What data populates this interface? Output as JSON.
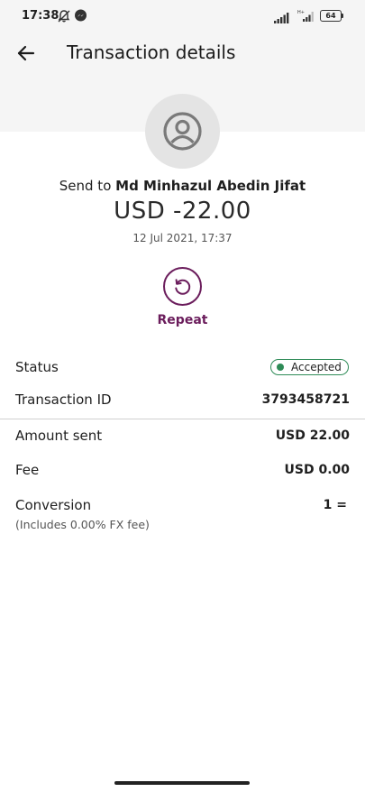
{
  "status_bar": {
    "time": "17:38",
    "battery": "64",
    "icons": [
      "alarm-off-icon",
      "messenger-icon",
      "signal-icon",
      "signal-icon",
      "battery-icon"
    ]
  },
  "header": {
    "title": "Transaction details",
    "back_icon": "arrow-left-icon"
  },
  "recipient": {
    "prefix": "Send to",
    "name": "Md Minhazul Abedin Jifat",
    "avatar_icon": "user-circle-icon"
  },
  "amount": "USD -22.00",
  "datetime": "12 Jul 2021, 17:37",
  "repeat": {
    "label": "Repeat",
    "icon": "repeat-icon"
  },
  "details": {
    "status_label": "Status",
    "status_value": "Accepted",
    "transaction_id_label": "Transaction ID",
    "transaction_id_value": "3793458721",
    "amount_sent_label": "Amount sent",
    "amount_sent_value": "USD 22.00",
    "fee_label": "Fee",
    "fee_value": "USD 0.00",
    "conversion_label": "Conversion",
    "conversion_value": "1 =",
    "fx_note": "(Includes 0.00% FX fee)"
  },
  "colors": {
    "accent": "#6b1d5c",
    "status_green": "#2e8b57",
    "header_bg": "#f5f5f5",
    "avatar_bg": "#e4e4e4"
  }
}
